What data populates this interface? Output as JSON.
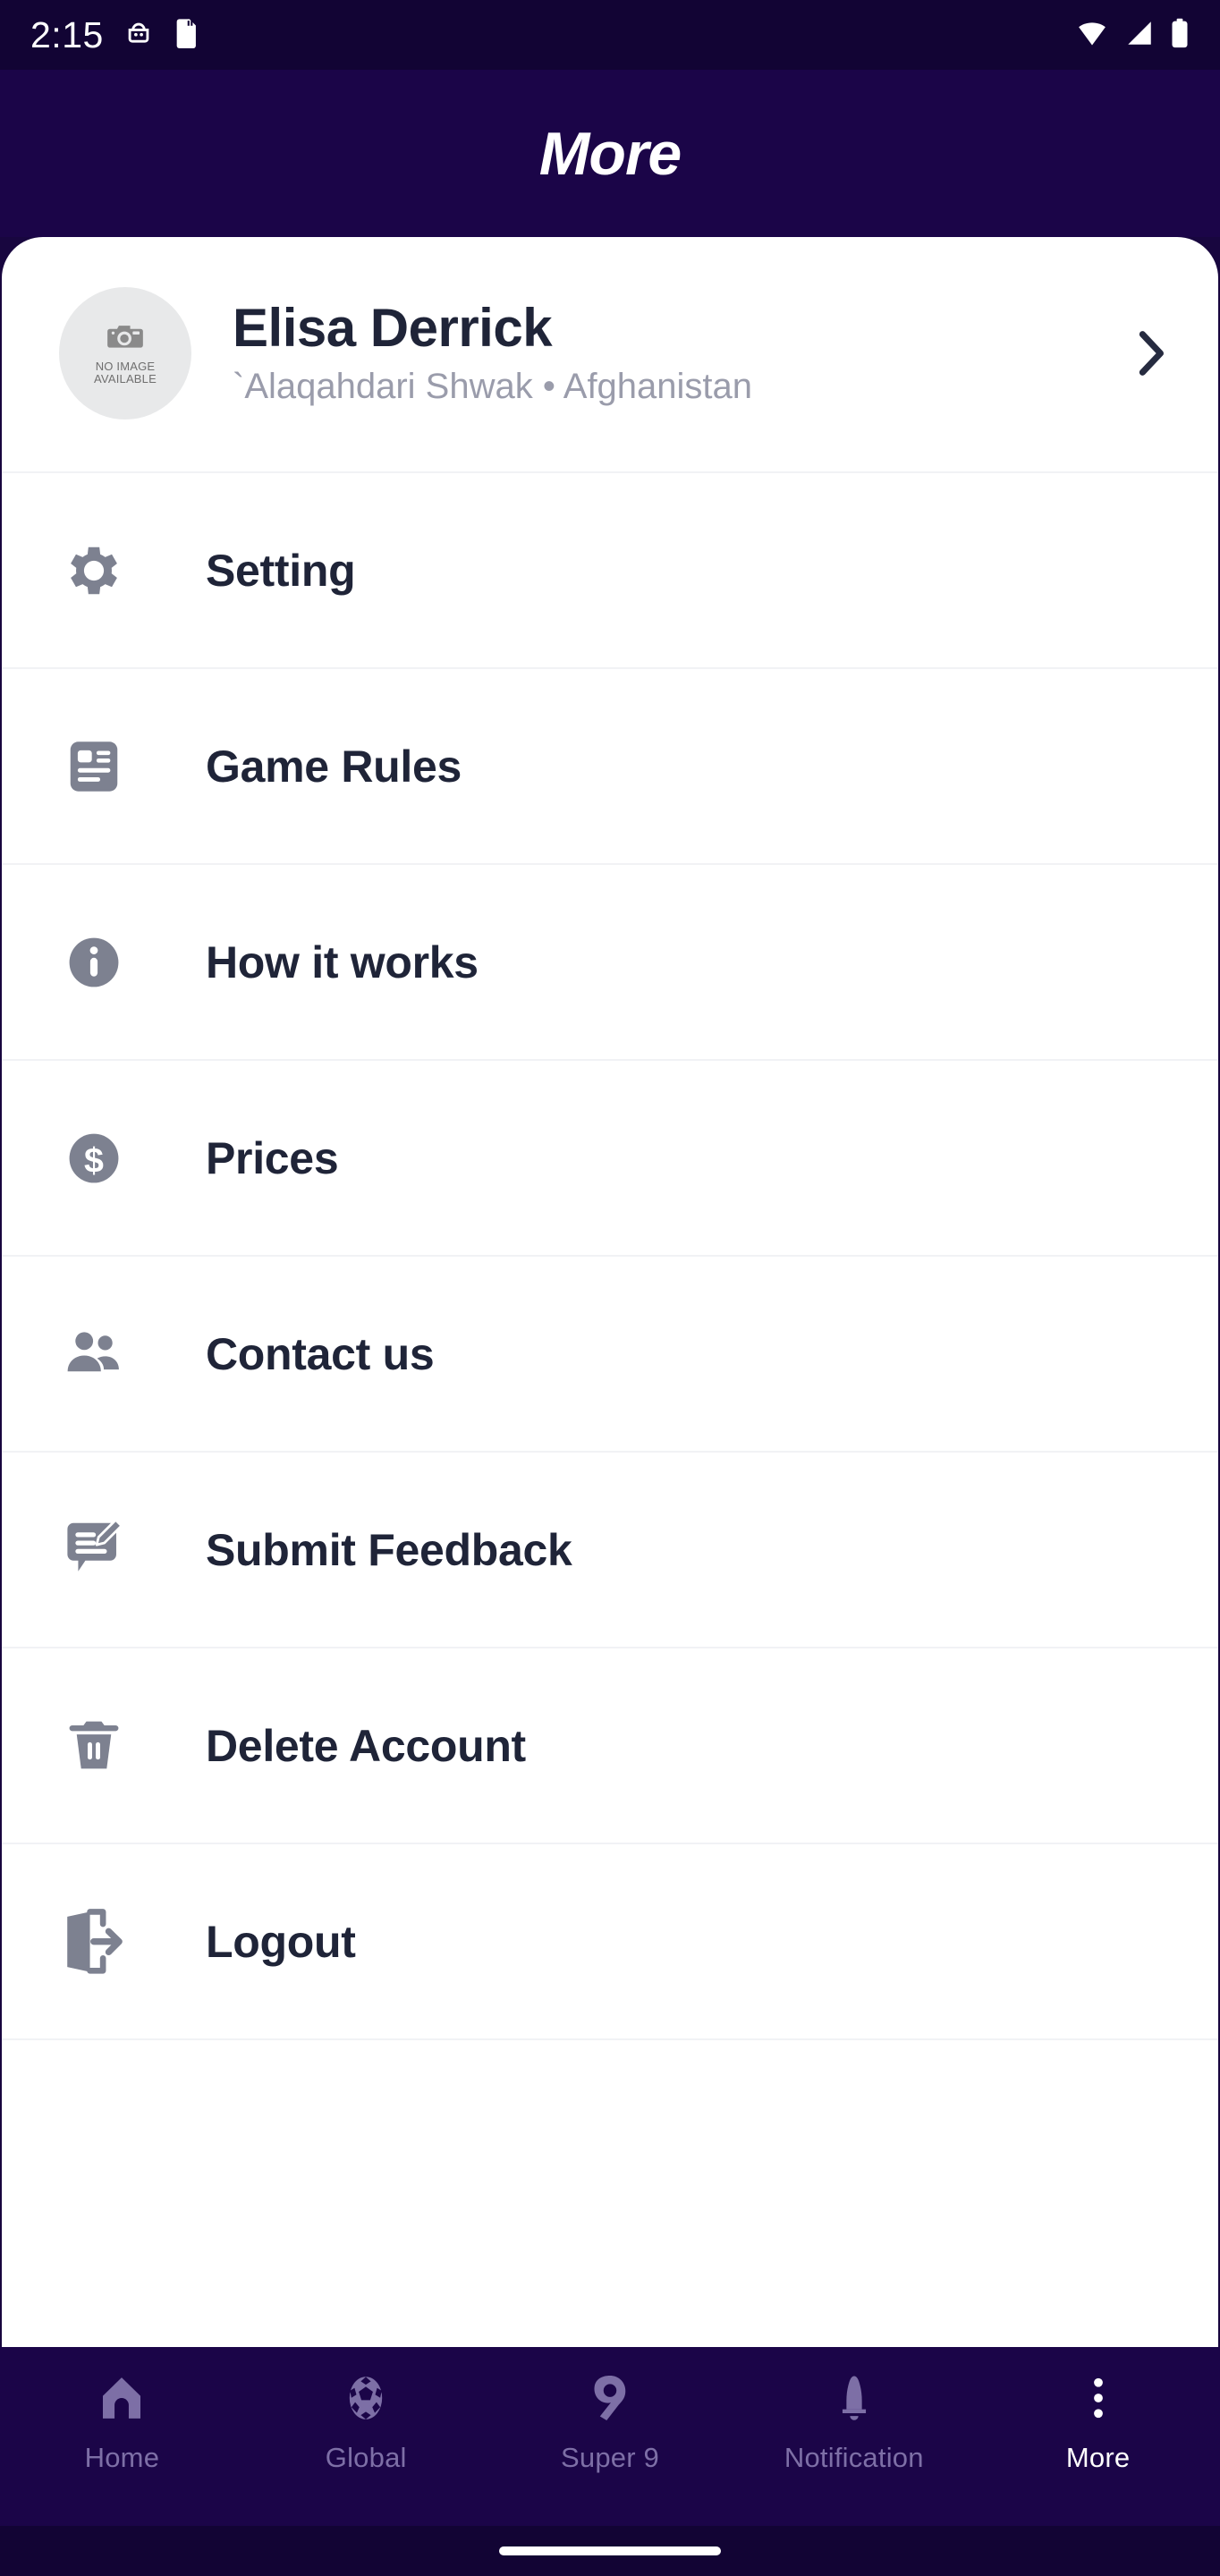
{
  "status_bar": {
    "time": "2:15",
    "left_icons": [
      "android-debug-icon",
      "sd-card-icon"
    ],
    "right_icons": [
      "wifi-icon",
      "cellular-signal-icon",
      "battery-icon"
    ]
  },
  "header": {
    "title": "More"
  },
  "profile": {
    "name": "Elisa Derrick",
    "location": "`Alaqahdari Shwak  •  Afghanistan",
    "avatar_placeholder_line1": "NO IMAGE",
    "avatar_placeholder_line2": "AVAILABLE",
    "avatar_icon": "camera-icon",
    "chevron_icon": "chevron-right-icon"
  },
  "menu": {
    "items": [
      {
        "label": "Setting",
        "icon": "gear-icon"
      },
      {
        "label": "Game Rules",
        "icon": "article-icon"
      },
      {
        "label": "How it works",
        "icon": "info-circle-icon"
      },
      {
        "label": "Prices",
        "icon": "dollar-circle-icon"
      },
      {
        "label": "Contact us",
        "icon": "people-icon"
      },
      {
        "label": "Submit Feedback",
        "icon": "feedback-pencil-icon"
      },
      {
        "label": "Delete Account",
        "icon": "trash-icon"
      },
      {
        "label": "Logout",
        "icon": "logout-door-icon"
      }
    ]
  },
  "bottom_nav": {
    "items": [
      {
        "label": "Home",
        "icon": "home-icon",
        "active": false
      },
      {
        "label": "Global",
        "icon": "soccer-ball-icon",
        "active": false
      },
      {
        "label": "Super 9",
        "icon": "super9-icon",
        "active": false
      },
      {
        "label": "Notification",
        "icon": "bell-icon",
        "active": false
      },
      {
        "label": "More",
        "icon": "more-dots-icon",
        "active": true
      }
    ]
  },
  "colors": {
    "header_bg": "#1b0548",
    "status_bg": "#120434",
    "sheet_bg": "#ffffff",
    "text_dark": "#1f2438",
    "text_muted": "#9a9cab",
    "icon_gray": "#7d8190",
    "nav_inactive": "#7d6fa6",
    "nav_active": "#ffffff",
    "divider": "#f1f2f5"
  }
}
